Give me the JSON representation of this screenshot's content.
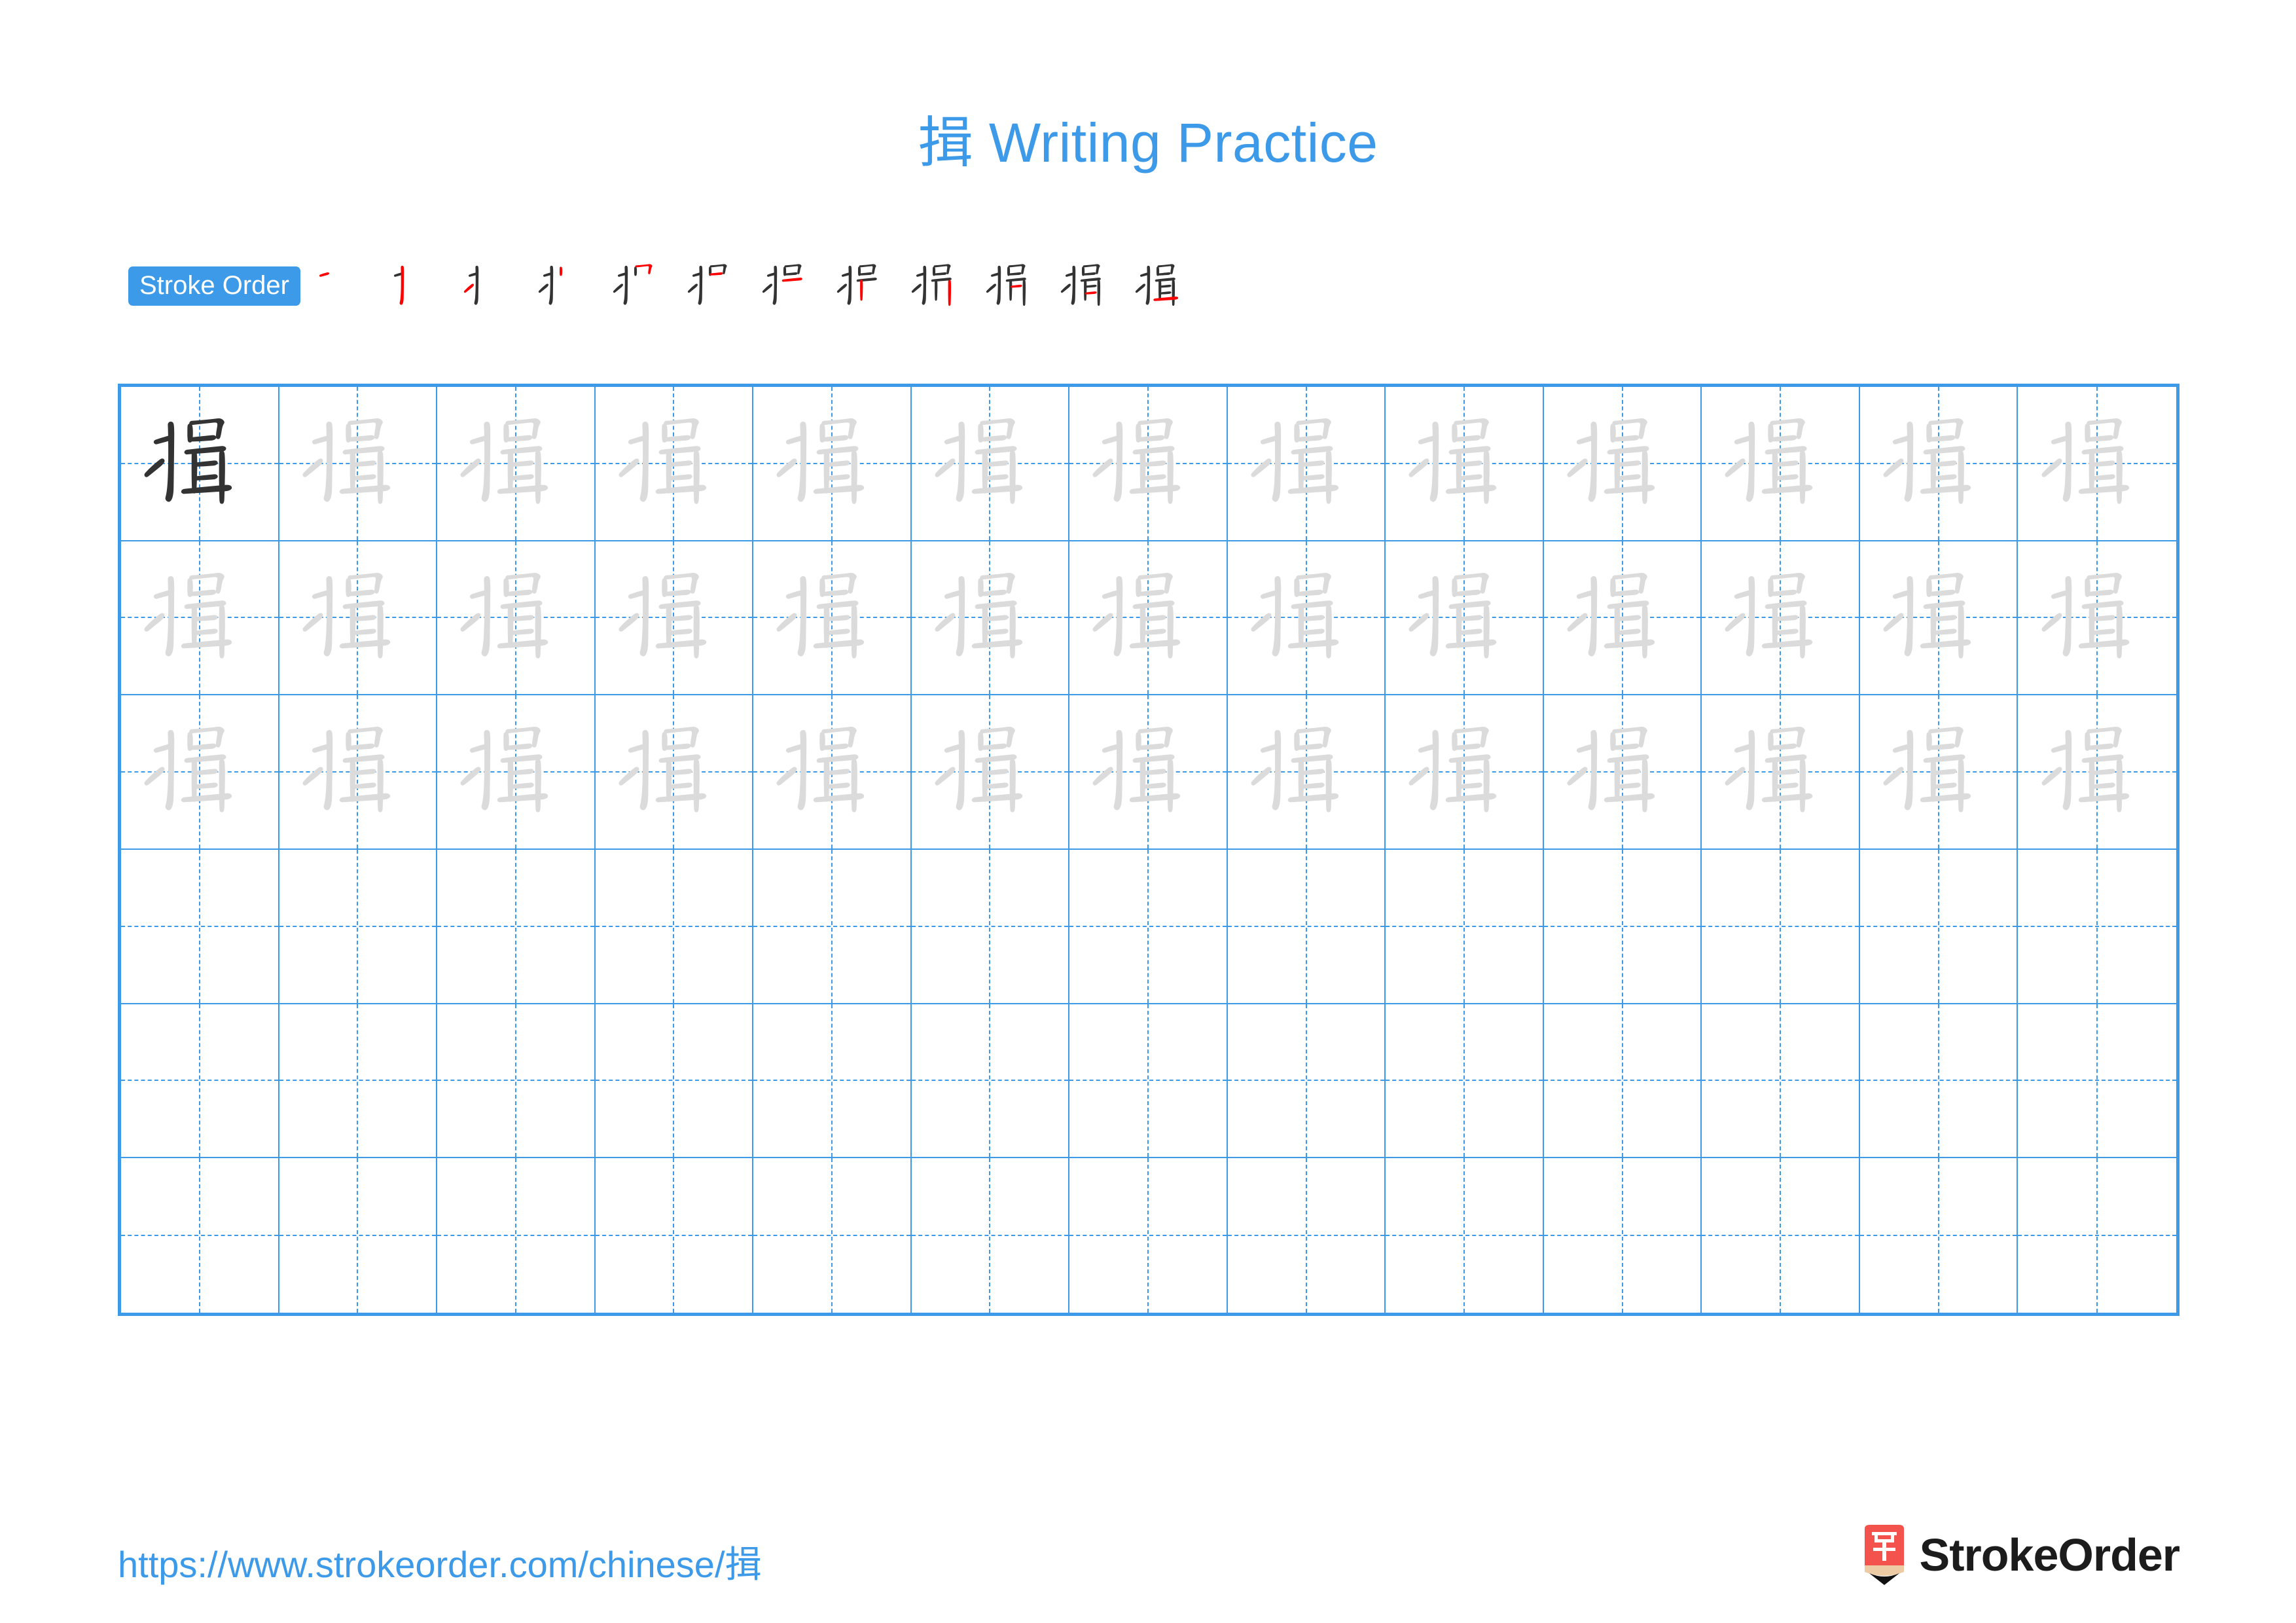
{
  "page": {
    "title": "揖 Writing Practice",
    "character": "揖",
    "background_color": "#ffffff"
  },
  "colors": {
    "accent_blue": "#3d9ae8",
    "grid_line": "#3d9ae8",
    "stroke_new": "#fe0000",
    "stroke_done": "#333333",
    "trace_gray": "#dbdbdb",
    "logo_red": "#f4524d",
    "logo_wood": "#edcba4",
    "logo_text": "#1c1c1c"
  },
  "stroke_order": {
    "badge_label": "Stroke Order",
    "total_strokes": 12,
    "steps": [
      {
        "index": 1,
        "strokes_shown": 1,
        "new_stroke_index": 1
      },
      {
        "index": 2,
        "strokes_shown": 2,
        "new_stroke_index": 2
      },
      {
        "index": 3,
        "strokes_shown": 3,
        "new_stroke_index": 3
      },
      {
        "index": 4,
        "strokes_shown": 4,
        "new_stroke_index": 4
      },
      {
        "index": 5,
        "strokes_shown": 5,
        "new_stroke_index": 5
      },
      {
        "index": 6,
        "strokes_shown": 6,
        "new_stroke_index": 6
      },
      {
        "index": 7,
        "strokes_shown": 7,
        "new_stroke_index": 7
      },
      {
        "index": 8,
        "strokes_shown": 8,
        "new_stroke_index": 8
      },
      {
        "index": 9,
        "strokes_shown": 9,
        "new_stroke_index": 9
      },
      {
        "index": 10,
        "strokes_shown": 10,
        "new_stroke_index": 10
      },
      {
        "index": 11,
        "strokes_shown": 11,
        "new_stroke_index": 11
      },
      {
        "index": 12,
        "strokes_shown": 12,
        "new_stroke_index": 12
      }
    ]
  },
  "practice_grid": {
    "columns": 13,
    "rows": 6,
    "character": "揖",
    "first_cell_style": "solid-dark",
    "traced_rows": 3,
    "blank_rows": 3,
    "guides": "dashed-cross"
  },
  "footer": {
    "url": "https://www.strokeorder.com/chinese/揖",
    "brand": "StrokeOrder",
    "logo_glyph": "字"
  }
}
